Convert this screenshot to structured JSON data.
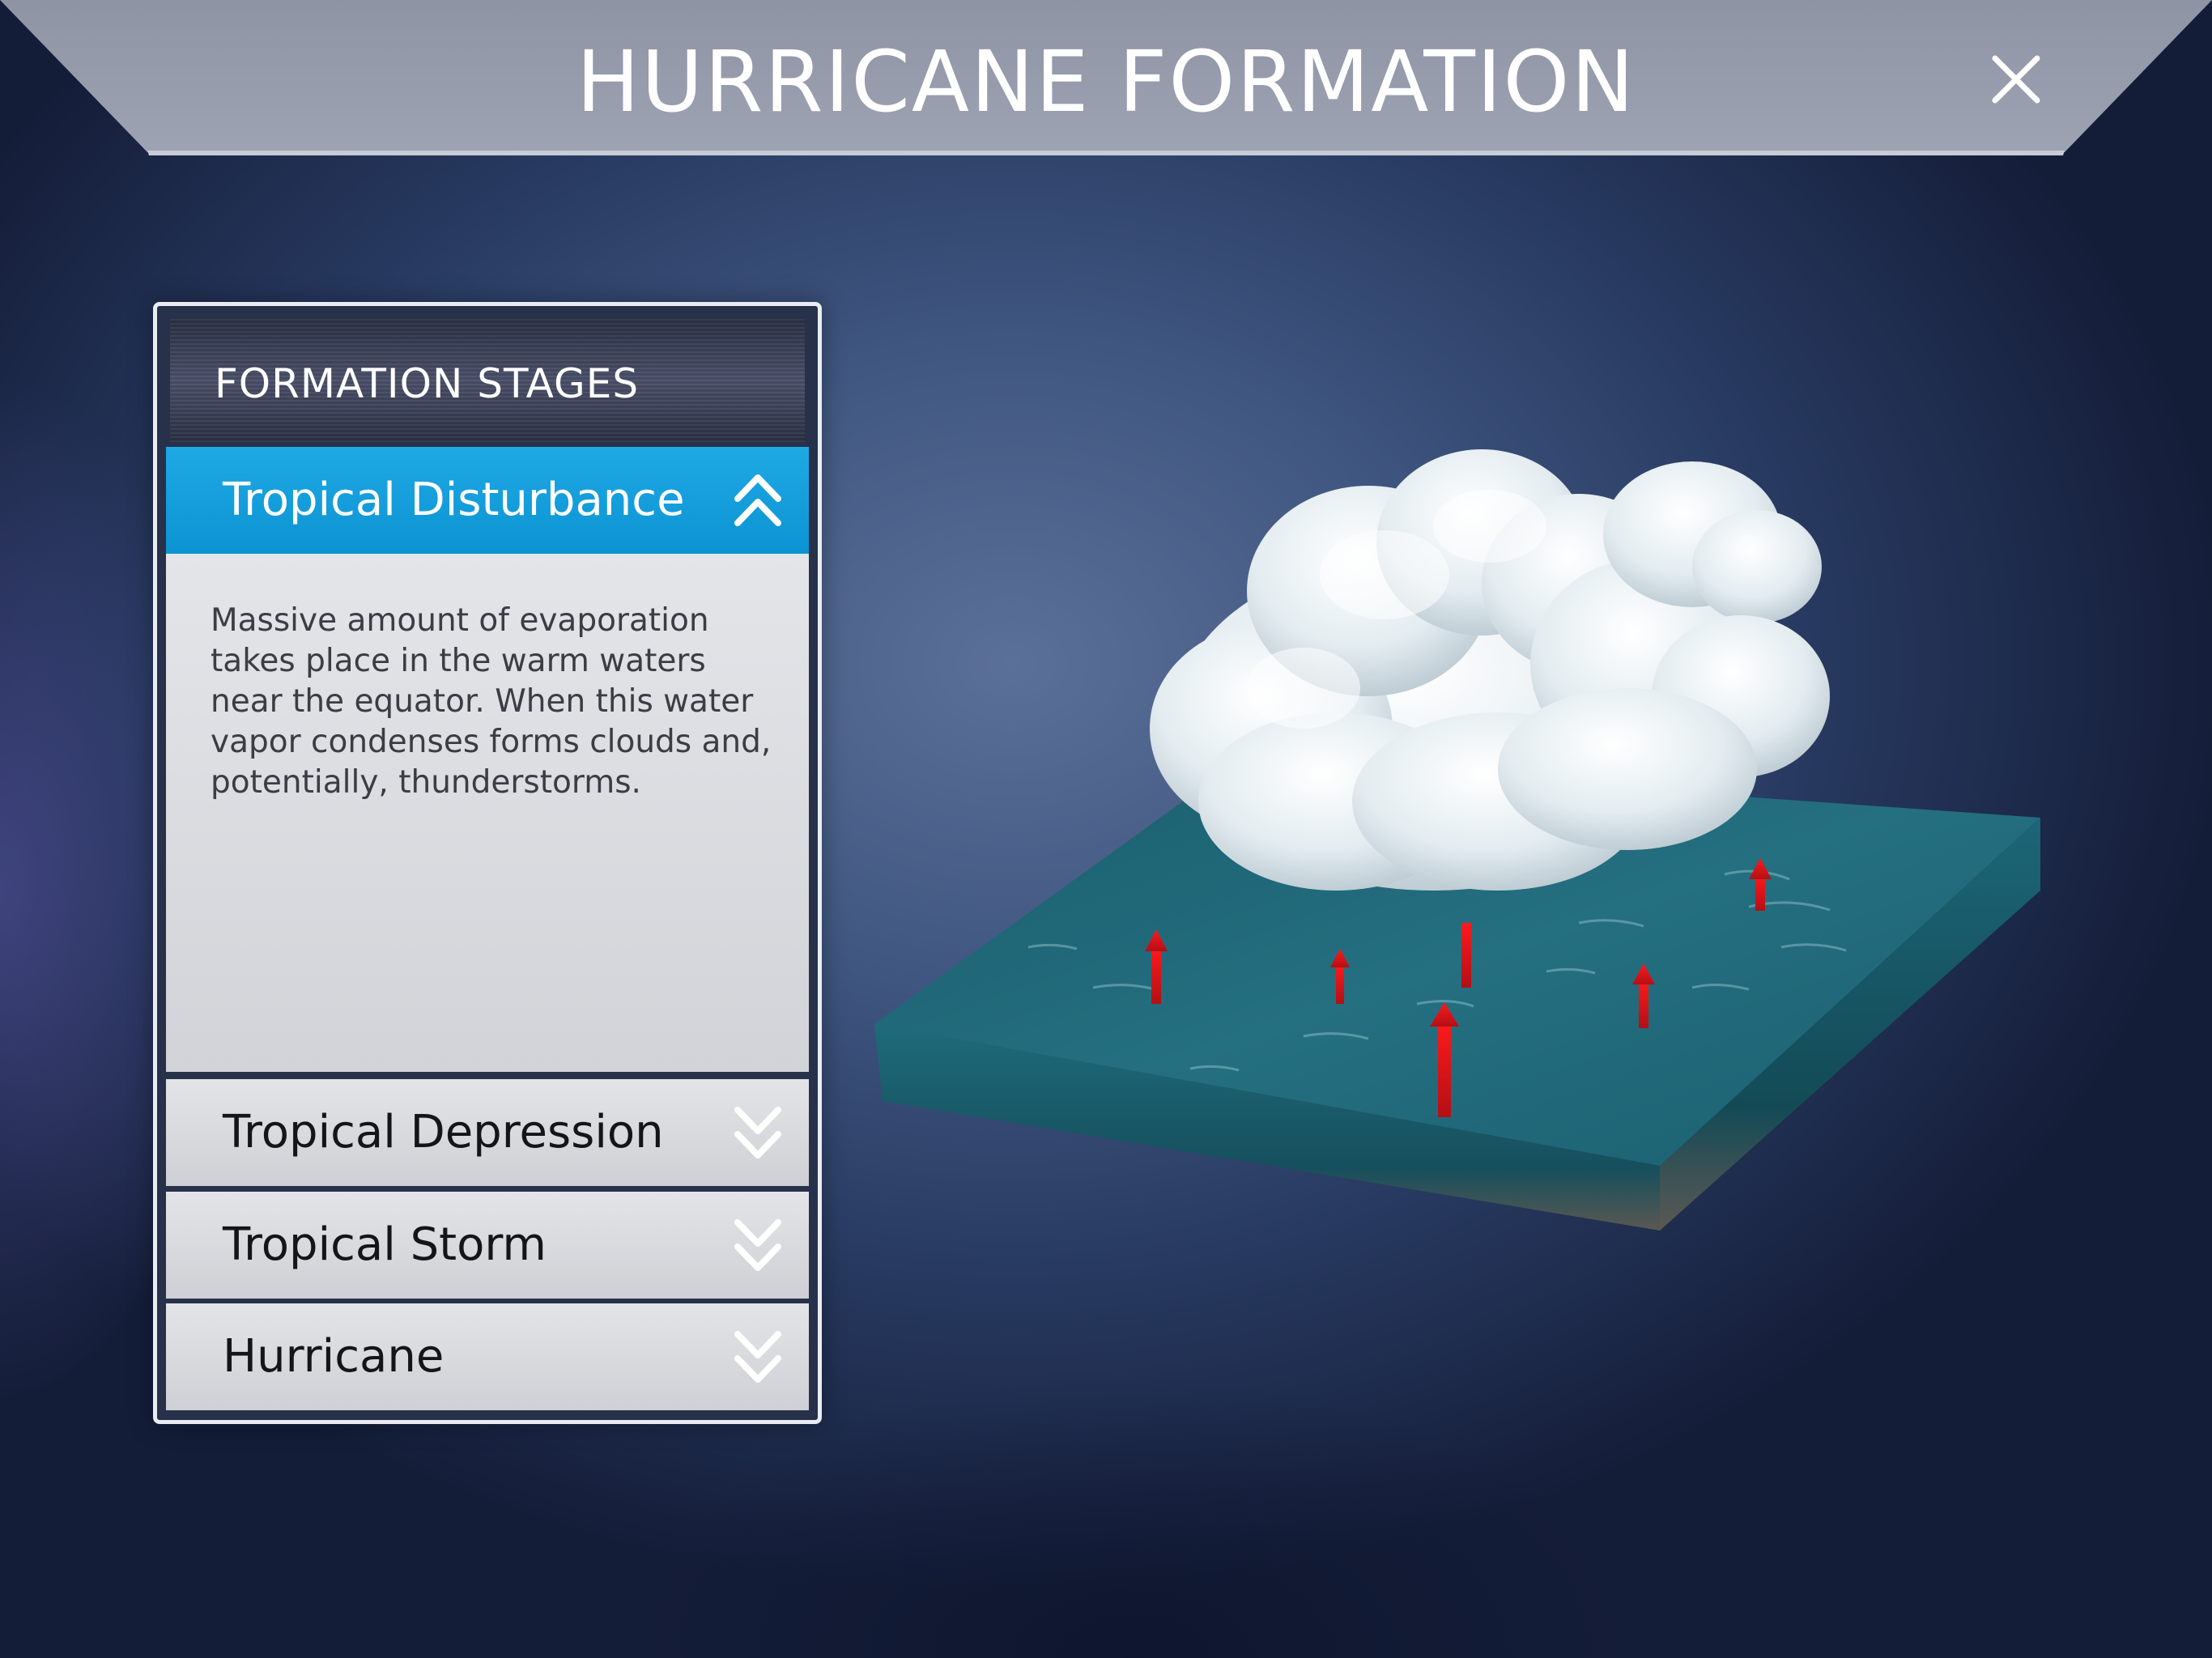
{
  "header": {
    "title": "HURRICANE FORMATION",
    "close_icon": "close-icon"
  },
  "panel": {
    "title": "FORMATION STAGES",
    "stages": [
      {
        "label": "Tropical Disturbance",
        "expanded": true,
        "icon": "chevron-double-up-icon"
      },
      {
        "label": "Tropical Depression",
        "expanded": false,
        "icon": "chevron-double-down-icon"
      },
      {
        "label": "Tropical Storm",
        "expanded": false,
        "icon": "chevron-double-down-icon"
      },
      {
        "label": "Hurricane",
        "expanded": false,
        "icon": "chevron-double-down-icon"
      }
    ],
    "description": "Massive amount of evaporation takes place in the warm waters near the equator. When this water vapor condenses forms clouds and, potentially, thunderstorms."
  },
  "scene": {
    "illustration": "ocean-with-cloud-and-evaporation-arrows",
    "colors": {
      "accent": "#0c93d3",
      "ocean": "#1e6878",
      "arrows": "#e8141a",
      "cloud": "#eef3f6"
    }
  }
}
